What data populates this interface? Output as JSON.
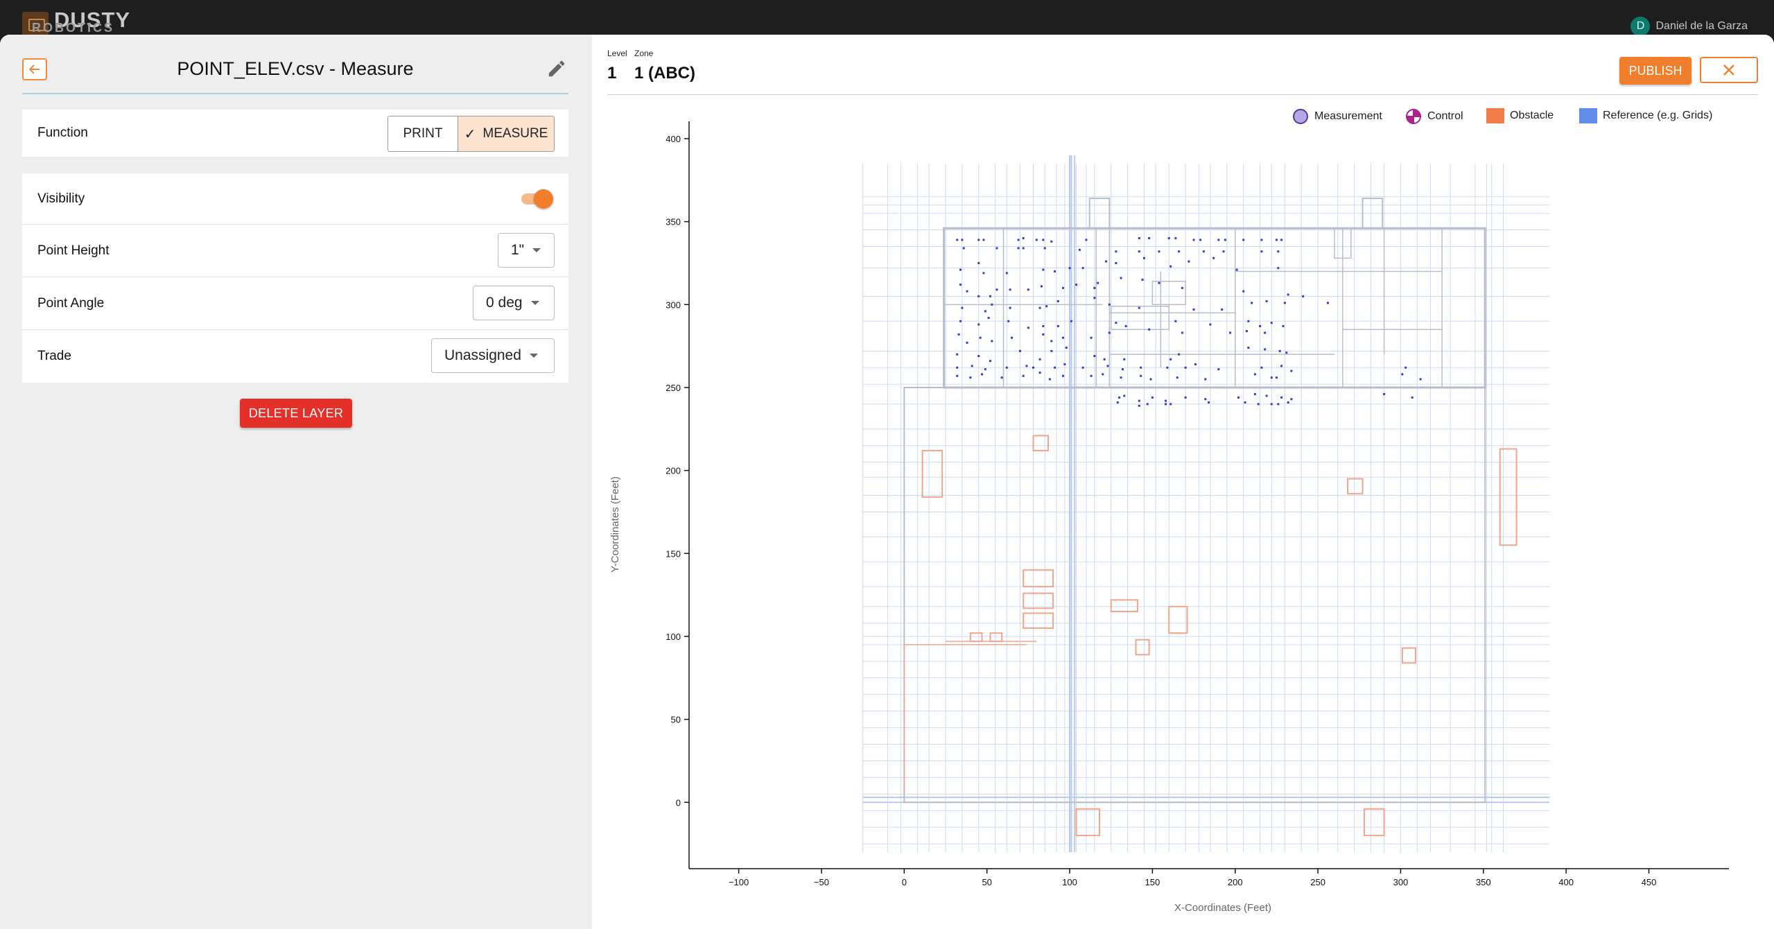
{
  "app": {
    "logo_text": "DUSTY",
    "logo_sub": "ROBOTICS",
    "user_initial": "D",
    "user_name": "Daniel de la Garza"
  },
  "layer_panel": {
    "title": "POINT_ELEV.csv - Measure",
    "function": {
      "label": "Function",
      "options": [
        "PRINT",
        "MEASURE"
      ],
      "selected": "MEASURE"
    },
    "visibility": {
      "label": "Visibility",
      "on": true
    },
    "point_height": {
      "label": "Point Height",
      "value": "1\""
    },
    "point_angle": {
      "label": "Point Angle",
      "value": "0 deg"
    },
    "trade": {
      "label": "Trade",
      "value": "Unassigned"
    },
    "delete_label": "DELETE LAYER"
  },
  "view": {
    "level_label": "Level",
    "level_value": "1",
    "zone_label": "Zone",
    "zone_value": "1 (ABC)",
    "publish_label": "PUBLISH"
  },
  "legend": [
    {
      "label": "Measurement",
      "icon": "measurement-circle-icon",
      "color": "#b7a6e6"
    },
    {
      "label": "Control",
      "icon": "control-crosshair-icon",
      "color": "#b0208a"
    },
    {
      "label": "Obstacle",
      "icon": "obstacle-square-icon",
      "color": "#f07d4a"
    },
    {
      "label": "Reference (e.g. Grids)",
      "icon": "reference-square-icon",
      "color": "#5f8de8"
    }
  ],
  "chart_data": {
    "type": "scatter",
    "xlabel": "X-Coordinates (Feet)",
    "ylabel": "Y-Coordinates (Feet)",
    "xlim": [
      -130,
      490
    ],
    "ylim": [
      -40,
      400
    ],
    "xticks": [
      -100,
      -50,
      0,
      50,
      100,
      150,
      200,
      250,
      300,
      350,
      400,
      450
    ],
    "yticks": [
      0,
      50,
      100,
      150,
      200,
      250,
      300,
      350,
      400
    ],
    "colors": {
      "measurement": "#3a3acb",
      "reference": "#c9d6f3",
      "obstacle": "#f1a58b",
      "outline": "#b9bdc8"
    },
    "obstacles": [
      {
        "x": 11,
        "y": 184,
        "w": 12,
        "h": 28
      },
      {
        "x": 78,
        "y": 212,
        "w": 9,
        "h": 9
      },
      {
        "x": 72,
        "y": 130,
        "w": 18,
        "h": 10
      },
      {
        "x": 72,
        "y": 117,
        "w": 18,
        "h": 9
      },
      {
        "x": 72,
        "y": 105,
        "w": 18,
        "h": 9
      },
      {
        "x": 125,
        "y": 115,
        "w": 16,
        "h": 7
      },
      {
        "x": 160,
        "y": 102,
        "w": 11,
        "h": 16
      },
      {
        "x": 140,
        "y": 89,
        "w": 8,
        "h": 9
      },
      {
        "x": 40,
        "y": 97,
        "w": 7,
        "h": 5
      },
      {
        "x": 52,
        "y": 97,
        "w": 7,
        "h": 5
      },
      {
        "x": 268,
        "y": 186,
        "w": 9,
        "h": 9
      },
      {
        "x": 301,
        "y": 84,
        "w": 8,
        "h": 9
      },
      {
        "x": 104,
        "y": -20,
        "w": 14,
        "h": 16
      },
      {
        "x": 278,
        "y": -20,
        "w": 12,
        "h": 16
      },
      {
        "x": 360,
        "y": 155,
        "w": 10,
        "h": 58
      }
    ],
    "measurements": [
      [
        32,
        339
      ],
      [
        35,
        339
      ],
      [
        45,
        339
      ],
      [
        48,
        339
      ],
      [
        69,
        339
      ],
      [
        72,
        340
      ],
      [
        80,
        339
      ],
      [
        84,
        339
      ],
      [
        89,
        338
      ],
      [
        110,
        339
      ],
      [
        142,
        340
      ],
      [
        148,
        340
      ],
      [
        160,
        340
      ],
      [
        164,
        340
      ],
      [
        175,
        339
      ],
      [
        179,
        339
      ],
      [
        190,
        339
      ],
      [
        194,
        339
      ],
      [
        205,
        339
      ],
      [
        216,
        339
      ],
      [
        225,
        339
      ],
      [
        228,
        339
      ],
      [
        36,
        334
      ],
      [
        56,
        334
      ],
      [
        69,
        334
      ],
      [
        72,
        334
      ],
      [
        85,
        334
      ],
      [
        106,
        333
      ],
      [
        128,
        332
      ],
      [
        142,
        332
      ],
      [
        154,
        332
      ],
      [
        166,
        332
      ],
      [
        181,
        332
      ],
      [
        193,
        332
      ],
      [
        216,
        332
      ],
      [
        226,
        332
      ],
      [
        34,
        321
      ],
      [
        45,
        325
      ],
      [
        48,
        319
      ],
      [
        62,
        319
      ],
      [
        84,
        321
      ],
      [
        91,
        320
      ],
      [
        100,
        322
      ],
      [
        108,
        322
      ],
      [
        122,
        326
      ],
      [
        128,
        325
      ],
      [
        145,
        328
      ],
      [
        161,
        323
      ],
      [
        172,
        326
      ],
      [
        187,
        328
      ],
      [
        201,
        321
      ],
      [
        226,
        322
      ],
      [
        34,
        312
      ],
      [
        38,
        308
      ],
      [
        45,
        305
      ],
      [
        52,
        305
      ],
      [
        56,
        309
      ],
      [
        64,
        309
      ],
      [
        75,
        309
      ],
      [
        83,
        311
      ],
      [
        96,
        310
      ],
      [
        104,
        312
      ],
      [
        115,
        310
      ],
      [
        117,
        313
      ],
      [
        131,
        316
      ],
      [
        144,
        315
      ],
      [
        154,
        313
      ],
      [
        168,
        310
      ],
      [
        205,
        308
      ],
      [
        232,
        306
      ],
      [
        241,
        305
      ],
      [
        256,
        301
      ],
      [
        35,
        298
      ],
      [
        49,
        296
      ],
      [
        53,
        300
      ],
      [
        64,
        298
      ],
      [
        82,
        298
      ],
      [
        86,
        299
      ],
      [
        93,
        302
      ],
      [
        115,
        304
      ],
      [
        124,
        300
      ],
      [
        142,
        298
      ],
      [
        175,
        297
      ],
      [
        192,
        297
      ],
      [
        210,
        301
      ],
      [
        219,
        302
      ],
      [
        230,
        301
      ],
      [
        34,
        290
      ],
      [
        45,
        288
      ],
      [
        51,
        292
      ],
      [
        63,
        290
      ],
      [
        75,
        286
      ],
      [
        84,
        287
      ],
      [
        93,
        287
      ],
      [
        101,
        290
      ],
      [
        128,
        289
      ],
      [
        134,
        287
      ],
      [
        164,
        290
      ],
      [
        185,
        288
      ],
      [
        208,
        290
      ],
      [
        215,
        287
      ],
      [
        222,
        289
      ],
      [
        229,
        287
      ],
      [
        33,
        282
      ],
      [
        38,
        277
      ],
      [
        46,
        280
      ],
      [
        53,
        278
      ],
      [
        65,
        280
      ],
      [
        84,
        282
      ],
      [
        89,
        278
      ],
      [
        96,
        280
      ],
      [
        113,
        280
      ],
      [
        124,
        283
      ],
      [
        148,
        285
      ],
      [
        168,
        283
      ],
      [
        197,
        283
      ],
      [
        207,
        284
      ],
      [
        218,
        283
      ],
      [
        32,
        270
      ],
      [
        45,
        269
      ],
      [
        52,
        266
      ],
      [
        70,
        272
      ],
      [
        82,
        267
      ],
      [
        89,
        272
      ],
      [
        98,
        274
      ],
      [
        115,
        269
      ],
      [
        121,
        267
      ],
      [
        133,
        267
      ],
      [
        161,
        267
      ],
      [
        166,
        270
      ],
      [
        208,
        274
      ],
      [
        218,
        273
      ],
      [
        227,
        272
      ],
      [
        231,
        271
      ],
      [
        32,
        262
      ],
      [
        41,
        263
      ],
      [
        49,
        261
      ],
      [
        62,
        262
      ],
      [
        74,
        263
      ],
      [
        78,
        262
      ],
      [
        91,
        262
      ],
      [
        97,
        264
      ],
      [
        108,
        262
      ],
      [
        123,
        263
      ],
      [
        132,
        261
      ],
      [
        143,
        262
      ],
      [
        159,
        262
      ],
      [
        170,
        262
      ],
      [
        176,
        264
      ],
      [
        190,
        261
      ],
      [
        216,
        262
      ],
      [
        228,
        263
      ],
      [
        234,
        260
      ],
      [
        303,
        262
      ],
      [
        32,
        257
      ],
      [
        40,
        256
      ],
      [
        47,
        258
      ],
      [
        59,
        256
      ],
      [
        72,
        257
      ],
      [
        82,
        259
      ],
      [
        88,
        255
      ],
      [
        96,
        257
      ],
      [
        113,
        257
      ],
      [
        120,
        258
      ],
      [
        131,
        256
      ],
      [
        143,
        257
      ],
      [
        149,
        255
      ],
      [
        165,
        256
      ],
      [
        182,
        255
      ],
      [
        212,
        258
      ],
      [
        222,
        256
      ],
      [
        225,
        256
      ],
      [
        301,
        258
      ],
      [
        312,
        255
      ],
      [
        130,
        244
      ],
      [
        133,
        245
      ],
      [
        142,
        242
      ],
      [
        150,
        244
      ],
      [
        158,
        242
      ],
      [
        170,
        244
      ],
      [
        182,
        243
      ],
      [
        202,
        244
      ],
      [
        212,
        246
      ],
      [
        219,
        245
      ],
      [
        228,
        244
      ],
      [
        234,
        243
      ],
      [
        290,
        246
      ],
      [
        307,
        244
      ],
      [
        129,
        241
      ],
      [
        142,
        239
      ],
      [
        147,
        240
      ],
      [
        158,
        240
      ],
      [
        161,
        240
      ],
      [
        184,
        241
      ],
      [
        206,
        241
      ],
      [
        214,
        240
      ],
      [
        222,
        240
      ],
      [
        226,
        240
      ],
      [
        232,
        241
      ]
    ]
  }
}
